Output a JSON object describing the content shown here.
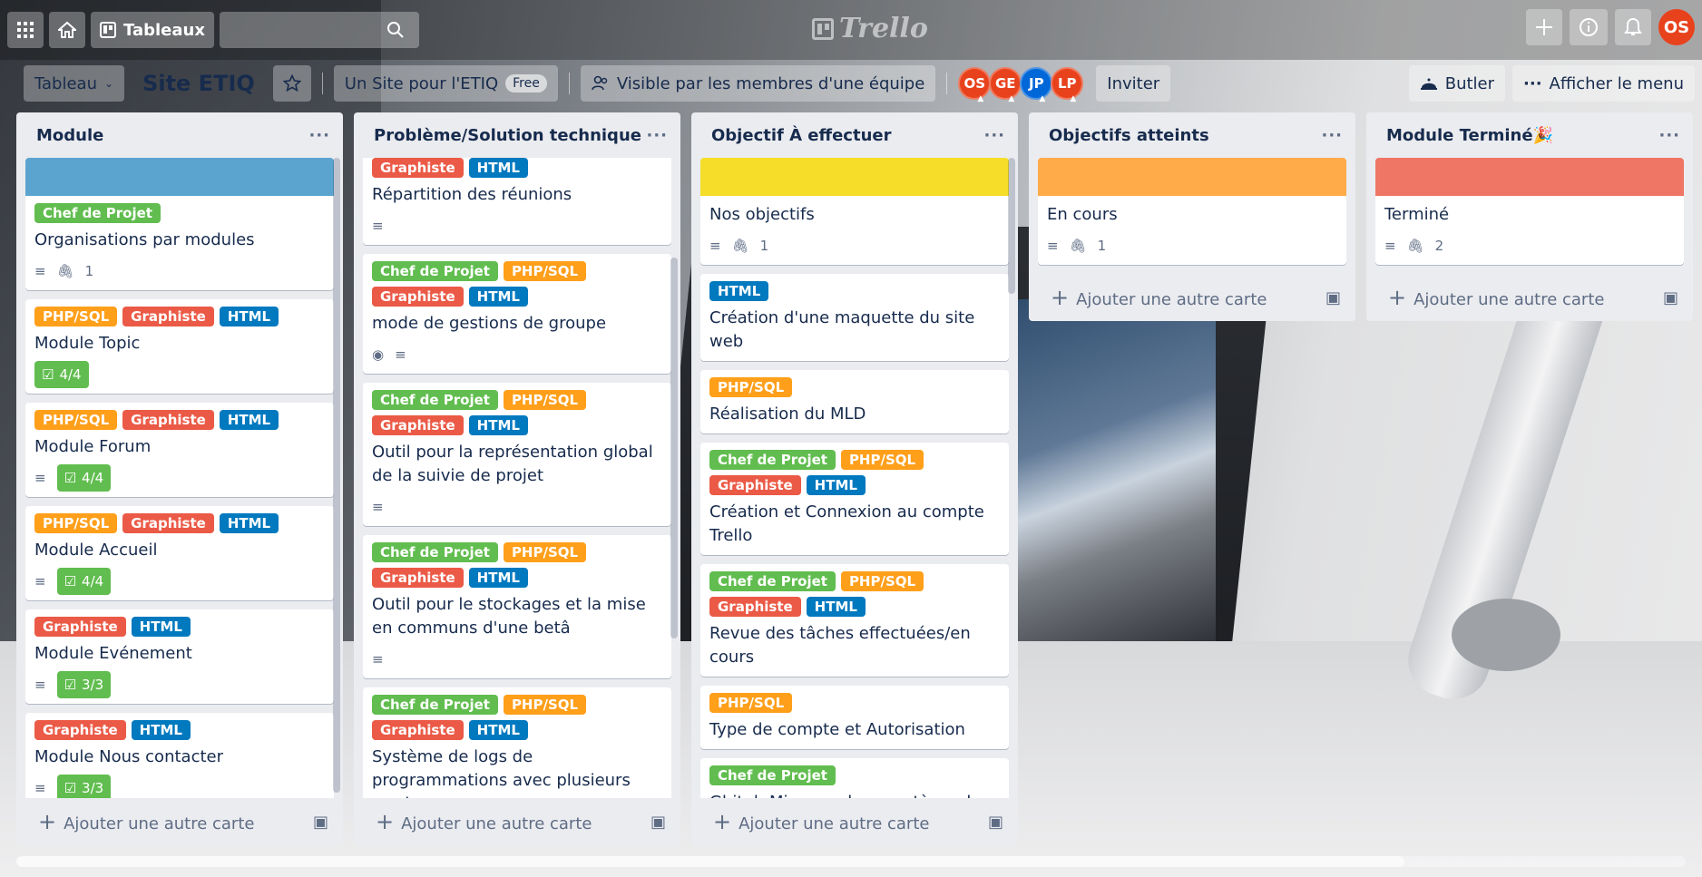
{
  "header": {
    "boards_label": "Tableaux",
    "logo_text": "Trello",
    "user_initials": "OS",
    "avatar_color": "#e8421c"
  },
  "boardbar": {
    "board_menu_label": "Tableau",
    "board_title": "Site ETIQ",
    "team_label": "Un Site pour l'ETIQ",
    "plan_badge": "Free",
    "visibility_label": "Visible par les membres d'une équipe",
    "members": [
      {
        "initials": "OS",
        "color": "#e8421c"
      },
      {
        "initials": "GE",
        "color": "#e8421c"
      },
      {
        "initials": "JP",
        "color": "#0067d8"
      },
      {
        "initials": "LP",
        "color": "#e8421c"
      }
    ],
    "invite_label": "Inviter",
    "butler_label": "Butler",
    "menu_label": "Afficher le menu"
  },
  "add_card_label": "Ajouter une autre carte",
  "label_colors": {
    "Chef de Projet": "#61bd4f",
    "PHP/SQL": "#ff9f1a",
    "Graphiste": "#eb5a46",
    "HTML": "#0079bf"
  },
  "lists": [
    {
      "title": "Module",
      "cards": [
        {
          "cover": "#5ba4cf",
          "labels": [
            "Chef de Projet"
          ],
          "title": "Organisations par modules",
          "desc": true,
          "attachments": "1"
        },
        {
          "labels": [
            "PHP/SQL",
            "Graphiste",
            "HTML"
          ],
          "title": "Module Topic",
          "checklist": "4/4"
        },
        {
          "labels": [
            "PHP/SQL",
            "Graphiste",
            "HTML"
          ],
          "title": "Module Forum",
          "desc": true,
          "checklist": "4/4"
        },
        {
          "labels": [
            "PHP/SQL",
            "Graphiste",
            "HTML"
          ],
          "title": "Module Accueil",
          "desc": true,
          "checklist": "4/4"
        },
        {
          "labels": [
            "Graphiste",
            "HTML"
          ],
          "title": "Module Evénement",
          "desc": true,
          "checklist": "3/3"
        },
        {
          "labels": [
            "Graphiste",
            "HTML"
          ],
          "title": "Module Nous contacter",
          "desc": true,
          "checklist": "3/3"
        }
      ]
    },
    {
      "title": "Problème/Solution technique",
      "cards": [
        {
          "labels": [
            "Graphiste",
            "HTML"
          ],
          "title": "Répartition des réunions",
          "desc": true
        },
        {
          "labels": [
            "Chef de Projet",
            "PHP/SQL",
            "Graphiste",
            "HTML"
          ],
          "title": "mode de gestions de groupe",
          "watch": true,
          "desc": true
        },
        {
          "labels": [
            "Chef de Projet",
            "PHP/SQL",
            "Graphiste",
            "HTML"
          ],
          "title": "Outil pour la représentation global de la suivie de projet",
          "desc": true
        },
        {
          "labels": [
            "Chef de Projet",
            "PHP/SQL",
            "Graphiste",
            "HTML"
          ],
          "title": "Outil pour le stockages et la mise en communs d'une betâ",
          "desc": true
        },
        {
          "labels": [
            "Chef de Projet",
            "PHP/SQL",
            "Graphiste",
            "HTML"
          ],
          "title": "Système de logs de programmations avec plusieurs verrions",
          "desc": false
        }
      ]
    },
    {
      "title": "Objectif À effectuer",
      "cards": [
        {
          "cover": "#f5dd29",
          "labels": [],
          "title": "Nos objectifs",
          "desc": true,
          "attachments": "1"
        },
        {
          "labels": [
            "HTML"
          ],
          "title": "Création d'une maquette du site web"
        },
        {
          "labels": [
            "PHP/SQL"
          ],
          "title": "Réalisation du MLD"
        },
        {
          "labels": [
            "Chef de Projet",
            "PHP/SQL",
            "Graphiste",
            "HTML"
          ],
          "title": "Création et Connexion au compte Trello"
        },
        {
          "labels": [
            "Chef de Projet",
            "PHP/SQL",
            "Graphiste",
            "HTML"
          ],
          "title": "Revue des tâches effectuées/en cours"
        },
        {
          "labels": [
            "PHP/SQL"
          ],
          "title": "Type de compte et Autorisation"
        },
        {
          "labels": [
            "Chef de Projet"
          ],
          "title": "Ghitub Mise en place système de logs"
        }
      ]
    },
    {
      "title": "Objectifs atteints",
      "cards": [
        {
          "cover": "#ffab4a",
          "labels": [],
          "title": "En cours",
          "desc": true,
          "attachments": "1"
        }
      ]
    },
    {
      "title": "Module Terminé",
      "title_emoji": "🎉",
      "cards": [
        {
          "cover": "#ef7564",
          "labels": [],
          "title": "Terminé",
          "desc": true,
          "attachments": "2"
        }
      ]
    }
  ]
}
